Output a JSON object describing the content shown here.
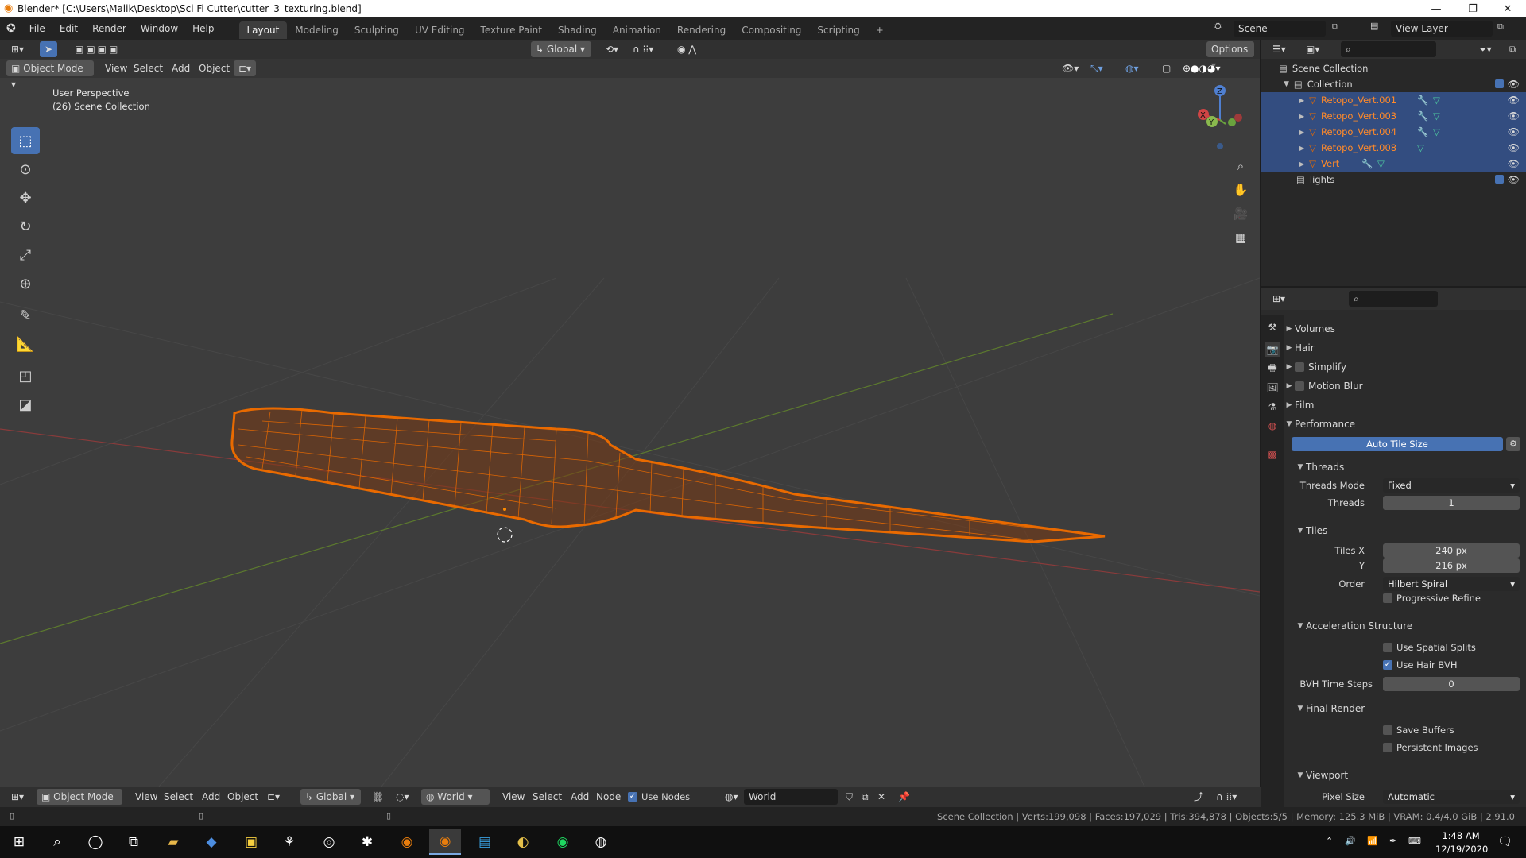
{
  "window": {
    "title": "Blender* [C:\\Users\\Malik\\Desktop\\Sci Fi Cutter\\cutter_3_texturing.blend]"
  },
  "menubar": {
    "menus": [
      "File",
      "Edit",
      "Render",
      "Window",
      "Help"
    ],
    "workspaces": [
      "Layout",
      "Modeling",
      "Sculpting",
      "UV Editing",
      "Texture Paint",
      "Shading",
      "Animation",
      "Rendering",
      "Compositing",
      "Scripting"
    ],
    "active_workspace": "Layout",
    "scene": "Scene",
    "view_layer": "View Layer"
  },
  "viewport": {
    "transform_orientation": "Global",
    "options_label": "Options",
    "mode": "Object Mode",
    "menu": [
      "View",
      "Select",
      "Add",
      "Object"
    ],
    "info_line1": "User Perspective",
    "info_line2": "(26) Scene Collection",
    "gizmo": {
      "x": "X",
      "y": "Y",
      "z": "Z"
    },
    "accent_color": "#e96a00"
  },
  "outliner": {
    "root": "Scene Collection",
    "collection": "Collection",
    "objects": [
      "Retopo_Vert.001",
      "Retopo_Vert.003",
      "Retopo_Vert.004",
      "Retopo_Vert.008",
      "Vert"
    ],
    "lights": "lights"
  },
  "properties": {
    "sections": [
      "Volumes",
      "Hair",
      "Simplify",
      "Motion Blur",
      "Film",
      "Performance"
    ],
    "auto_tile": "Auto Tile Size",
    "threads": {
      "title": "Threads",
      "mode_label": "Threads Mode",
      "mode_value": "Fixed",
      "threads_label": "Threads",
      "threads_value": "1"
    },
    "tiles": {
      "title": "Tiles",
      "x_label": "Tiles X",
      "x_value": "240 px",
      "y_label": "Y",
      "y_value": "216 px",
      "order_label": "Order",
      "order_value": "Hilbert Spiral",
      "progressive": "Progressive Refine"
    },
    "accel": {
      "title": "Acceleration Structure",
      "spatial": "Use Spatial Splits",
      "hair_bvh": "Use Hair BVH",
      "bvh_label": "BVH Time Steps",
      "bvh_value": "0"
    },
    "final": {
      "title": "Final Render",
      "save_buffers": "Save Buffers",
      "persistent": "Persistent Images"
    },
    "viewport": {
      "title": "Viewport",
      "pixel_label": "Pixel Size",
      "pixel_value": "Automatic"
    }
  },
  "node_header": {
    "mode": "Object Mode",
    "menu1": [
      "View",
      "Select",
      "Add",
      "Object"
    ],
    "orientation": "Global",
    "world_type": "World",
    "menu2": [
      "View",
      "Select",
      "Add",
      "Node"
    ],
    "use_nodes": "Use Nodes",
    "world_name": "World"
  },
  "statusbar": {
    "text": "Scene Collection | Verts:199,098 | Faces:197,029 | Tris:394,878 | Objects:5/5 | Memory: 125.3 MiB | VRAM: 0.4/4.0 GiB | 2.91.0"
  },
  "taskbar": {
    "time": "1:48 AM",
    "date": "12/19/2020"
  }
}
